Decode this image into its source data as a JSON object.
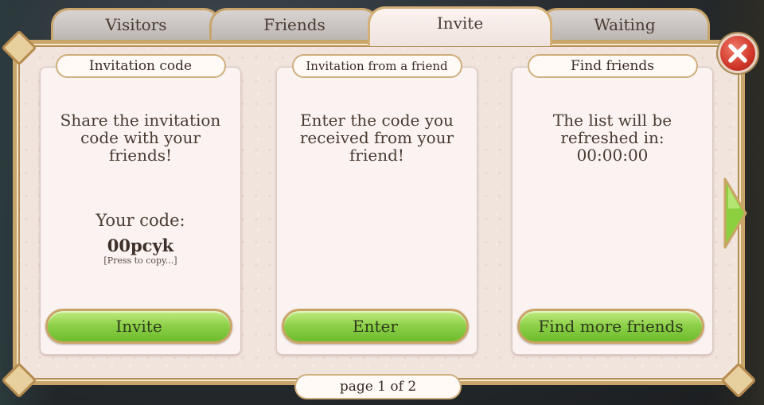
{
  "tabs": [
    {
      "label": "Visitors"
    },
    {
      "label": "Friends"
    },
    {
      "label": "Invite"
    },
    {
      "label": "Waiting"
    }
  ],
  "active_tab": "Invite",
  "panels": {
    "invitation_code": {
      "header": "Invitation code",
      "text": "Share the invitation code with your friends!",
      "code_label": "Your code:",
      "code_value": "00pcyk",
      "code_hint": "[Press to copy...]",
      "button": "Invite"
    },
    "from_friend": {
      "header": "Invitation from a friend",
      "text": "Enter the code you received from your friend!",
      "button": "Enter"
    },
    "find_friends": {
      "header": "Find friends",
      "text": "The list will be refreshed in:",
      "timer": "00:00:00",
      "button": "Find more friends"
    }
  },
  "pagination": {
    "text": "page 1 of 2",
    "current": 1,
    "total": 2
  },
  "icons": {
    "close": "close-icon",
    "next": "arrow-right-icon"
  },
  "colors": {
    "button_green": "#8fd24a",
    "close_red": "#cf3628",
    "frame_gold": "#c9a56c"
  }
}
